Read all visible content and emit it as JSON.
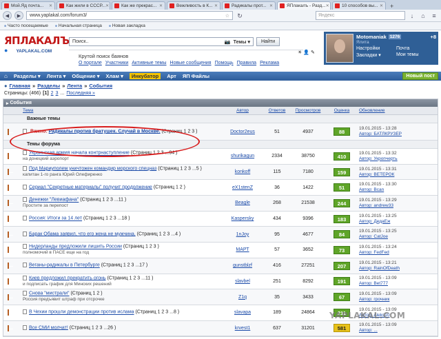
{
  "browser": {
    "tabs": [
      {
        "label": "Мой.Яд почта...",
        "active": false
      },
      {
        "label": "Как жили в СССР...",
        "active": false
      },
      {
        "label": "Как же прекрас...",
        "active": false
      },
      {
        "label": "Вежливость в К...",
        "active": false
      },
      {
        "label": "Радикалы прот...",
        "active": false
      },
      {
        "label": "ЯПлакалъ - Разд...",
        "active": true
      },
      {
        "label": "10 способов вы...",
        "active": false
      }
    ],
    "url": "www.yaplakal.com/forum3/",
    "search_placeholder": "Яндекс",
    "bookmarks": [
      "Часто посещаемые",
      "Начальная страница",
      "Новая закладка"
    ]
  },
  "site": {
    "logo_main": "ЯПЛАКАЛЪ",
    "logo_sub": "YAPLAKAL.COM",
    "search_value": "Поиск..",
    "search_scope": "Темы",
    "find_label": "Найти",
    "slogan": "Крутой поиск баянов",
    "links": [
      "О портале",
      "Участники",
      "Активные темы",
      "Новые сообщения",
      "Помощь",
      "Правила",
      "Реклама"
    ]
  },
  "user": {
    "name": "Motomaniak",
    "karma": "1276",
    "plus": "+8",
    "role": "Ялита",
    "settings": "Настройки",
    "bookmarks": "Закладки",
    "mail": "Почта",
    "my_topics": "Мои темы"
  },
  "menu": {
    "home": "⌂",
    "items": [
      "Разделы",
      "Лента",
      "Общение",
      "Хлам",
      "Инкубатор",
      "Арт",
      "ЯП Файлы"
    ],
    "highlighted": "Инкубатор",
    "new_post": "Новый пост"
  },
  "breadcrumb": {
    "items": [
      "Главная",
      "Разделы",
      "Лента",
      "События"
    ],
    "pages_label": "Страницы: (466)",
    "current": "[1]",
    "pages": [
      "2",
      "3"
    ],
    "last": "Последняя »"
  },
  "forum": {
    "title": "События",
    "columns": [
      "Тема",
      "Автор",
      "Ответов",
      "Просмотров",
      "Оценка",
      "Обновление"
    ],
    "important_section": "Важные темы",
    "forum_section": "Темы форума",
    "important_row": {
      "prefix": "Важно:",
      "title": "Радикалы против братушек. Случай в Москве.",
      "pages": "(Страниц 1 2 3 )",
      "author": "Doctor2eus",
      "replies": "51",
      "views": "4937",
      "score": "88",
      "updated": "19.01.2015 - 13:28",
      "by": "Автор: БАТЛКРУЗЕР"
    },
    "rows": [
      {
        "title": "Украинская армия начала контрнаступление",
        "pages": "(Страниц 1 2 3 ...94 )",
        "desc": "на донецкий аэропорт",
        "author": "shurikagun",
        "replies": "2334",
        "views": "38750",
        "score": "410",
        "score_color": "green",
        "updated": "19.01.2015 - 13:32",
        "by": "Автор: Укропчерть"
      },
      {
        "title": "Под Мариуполем уничтожен командир морского спецназ",
        "pages": "(Страниц 1 2 3 ...5 )",
        "desc": "капитан 1-го ранга Юрий Олефиренко",
        "author": "konkoff",
        "replies": "115",
        "views": "7180",
        "score": "159",
        "score_color": "green",
        "updated": "19.01.2015 - 13:31",
        "by": "Автор: ВЕТЕРОК"
      },
      {
        "title": "Сериал \"Секретные материалы\" получит продолжение",
        "pages": "(Страниц 1 2 )",
        "desc": "",
        "author": "eX1stenZ",
        "replies": "36",
        "views": "1422",
        "score": "51",
        "score_color": "green",
        "updated": "19.01.2015 - 13:30",
        "by": "Автор: Bcan"
      },
      {
        "title": "Денежки \"Левиафана\"",
        "pages": "(Страниц 1 2 3 ...11 )",
        "desc": "Простите за перепост",
        "author": "Beagle",
        "replies": "268",
        "views": "21538",
        "score": "244",
        "score_color": "green",
        "updated": "19.01.2015 - 13:29",
        "by": "Автор: andrew33"
      },
      {
        "title": "Россия: Итоги за 14 лет",
        "pages": "(Страниц 1 2 3 ...18 )",
        "desc": "",
        "author": "Kaspersky",
        "replies": "434",
        "views": "9396",
        "score": "183",
        "score_color": "green",
        "updated": "19.01.2015 - 13:25",
        "by": "Автор: ДедаЕж"
      },
      {
        "title": "Барак Обама заявил, что его жена не мужчина.",
        "pages": "(Страниц 1 2 3 ...4 )",
        "desc": "",
        "author": "1nJoy",
        "replies": "95",
        "views": "4677",
        "score": "84",
        "score_color": "green",
        "updated": "19.01.2015 - 13:25",
        "by": "Автор: CatJoe"
      },
      {
        "title": "Нидерланды предложили лишить России",
        "pages": "(Страниц 1 2 3 )",
        "desc": "полномочий в ПАСЕ еще на год",
        "author": "МАРТ",
        "replies": "57",
        "views": "3652",
        "score": "73",
        "score_color": "green",
        "updated": "19.01.2015 - 13:24",
        "by": "Автор: FedFed"
      },
      {
        "title": "Веганы-радикалы в Петербурге",
        "pages": "(Страниц 1 2 3 ...17 )",
        "desc": "",
        "author": "gunstblzf",
        "replies": "416",
        "views": "27251",
        "score": "207",
        "score_color": "green",
        "updated": "19.01.2015 - 13:21",
        "by": "Автор: RainOfDeath"
      },
      {
        "title": "Киев предложил прекратить огонь",
        "pages": "(Страниц 1 2 3 ...11 )",
        "desc": "и подписать график для Минских решений",
        "author": "slavbel",
        "replies": "251",
        "views": "8292",
        "score": "191",
        "score_color": "green",
        "updated": "19.01.2015 - 13:09",
        "by": "Автор: Bet777"
      },
      {
        "title": "Снова \"мистрали\"",
        "pages": "(Страниц 1 2 )",
        "desc": "Россия предъявит штраф при отсрочке",
        "author": "Z1q",
        "replies": "35",
        "views": "3433",
        "score": "67",
        "score_color": "green",
        "updated": "19.01.2015 - 13:09",
        "by": "Автор: грочник"
      },
      {
        "title": "В Чехии прошли демонстрации против ислама",
        "pages": "(Страниц 1 2 3 ...8 )",
        "desc": "",
        "author": "slavapa",
        "replies": "189",
        "views": "24864",
        "score": "211",
        "score_color": "green",
        "updated": "19.01.2015 - 13:09",
        "by": "Автор: Aleks10"
      },
      {
        "title": "Все СМИ молчат!",
        "pages": "(Страниц 1 2 3 ...26 )",
        "desc": "",
        "author": "krvest1",
        "replies": "637",
        "views": "31201",
        "score": "581",
        "score_color": "yellow",
        "updated": "19.01.2015 - 13:09",
        "by": "Автор: ..."
      }
    ]
  },
  "watermark": "YAPLAKAL.COM"
}
